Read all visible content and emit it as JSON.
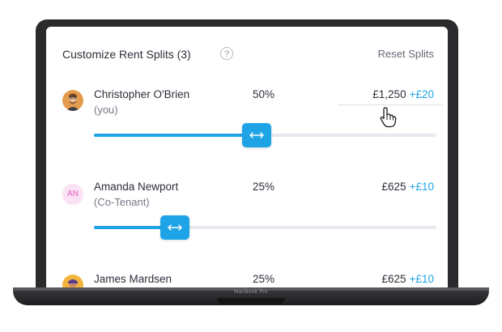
{
  "device": {
    "brand_label": "MacBook Pro"
  },
  "panel": {
    "title": "Customize Rent Splits (3)",
    "help_glyph": "?",
    "reset_label": "Reset Splits"
  },
  "tenants": [
    {
      "name": "Christopher O'Brien",
      "subtitle": "(you)",
      "percent_label": "50%",
      "amount": "£1,250",
      "delta": "+£20",
      "split_fraction": 0.5,
      "avatar": "photo-avatar"
    },
    {
      "name": "Amanda Newport",
      "subtitle": "(Co-Tenant)",
      "initials": "AN",
      "percent_label": "25%",
      "amount": "£625",
      "delta": "+£10",
      "split_fraction": 0.25,
      "avatar": "initials-avatar"
    },
    {
      "name": "James Mardsen",
      "percent_label": "25%",
      "amount": "£625",
      "delta": "+£10",
      "split_fraction": 0.25,
      "avatar": "photo-avatar"
    }
  ],
  "colors": {
    "accent": "#1ea4e6",
    "track": "#e7eaef",
    "text": "#2c2f3a",
    "muted": "#737885",
    "initials_bg": "#fbe1f4",
    "initials_text": "#e25fbf"
  },
  "icons": {
    "help": "question-circle-icon",
    "slider_handle": "left-right-arrows-icon",
    "pointer": "hand-pointer-icon"
  }
}
